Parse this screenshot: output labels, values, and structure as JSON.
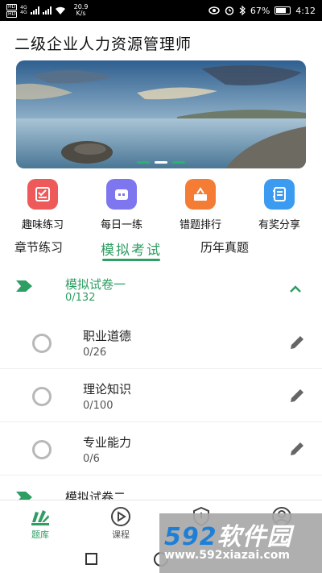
{
  "status_bar": {
    "hd1": "HD",
    "hd2": "HD",
    "net1": "4G",
    "net2": "4G",
    "speed": "20.9",
    "speed_unit": "K/s",
    "battery": "67%",
    "time": "4:12"
  },
  "header": {
    "title": "二级企业人力资源管理师"
  },
  "banner": {
    "slides": 3,
    "active_slide": 2
  },
  "quick_actions": [
    {
      "label": "趣味练习",
      "icon": "exam-sheet-icon",
      "color": "#ee5a5a"
    },
    {
      "label": "每日一练",
      "icon": "calendar-icon",
      "color": "#7d76ee"
    },
    {
      "label": "错题排行",
      "icon": "ranking-icon",
      "color": "#f57c35"
    },
    {
      "label": "有奖分享",
      "icon": "notebook-icon",
      "color": "#3b9bf0"
    }
  ],
  "tabs": [
    {
      "label": "章节练习",
      "active": false
    },
    {
      "label": "模拟考试",
      "active": true
    },
    {
      "label": "历年真题",
      "active": false
    }
  ],
  "sections": [
    {
      "title": "模拟试卷一",
      "count": "0/132",
      "expanded": true,
      "items": [
        {
          "title": "职业道德",
          "count": "0/26"
        },
        {
          "title": "理论知识",
          "count": "0/100"
        },
        {
          "title": "专业能力",
          "count": "0/6"
        }
      ]
    },
    {
      "title": "模拟试卷二",
      "expanded": false
    }
  ],
  "bottom_nav": [
    {
      "label": "题库",
      "icon": "books-icon",
      "active": true
    },
    {
      "label": "课程",
      "icon": "play-circle-icon",
      "active": false
    },
    {
      "label": "",
      "icon": "shield-icon",
      "active": false
    },
    {
      "label": "",
      "icon": "user-icon",
      "active": false
    }
  ],
  "watermark": {
    "brand_num": "592",
    "brand_text": "软件园",
    "url": "www.592xiazai.com"
  },
  "colors": {
    "accent": "#2e9e63",
    "status_bar": "#000000"
  }
}
